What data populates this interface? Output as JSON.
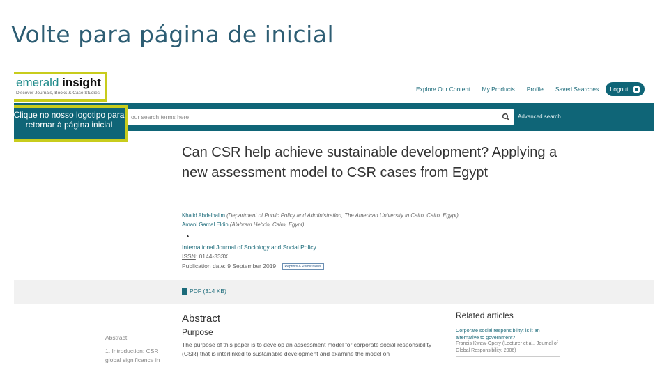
{
  "slide": {
    "title": "Volte para página de inicial"
  },
  "logo": {
    "part1": "emerald",
    "part2": " insight",
    "tagline": "Discover Journals, Books & Case Studies"
  },
  "callout": {
    "text": "Clique no nosso logotipo para retornar à página inicial"
  },
  "nav": {
    "items": [
      "Explore Our Content",
      "My Products",
      "Profile",
      "Saved Searches"
    ],
    "logout_label": "Logout"
  },
  "search": {
    "placeholder": "our search terms here",
    "advanced_label": "Advanced search"
  },
  "article": {
    "title": "Can CSR help achieve sustainable development? Applying a new assessment model to CSR cases from Egypt",
    "authors": [
      {
        "name": "Khalid Abdelhalim",
        "affiliation": " (Department of Public Policy and Administration, The American University in Cairo, Cairo, Egypt)"
      },
      {
        "name": "Amani Gamal Eldin",
        "affiliation": " (Alahram Hebdo, Cairo, Egypt)"
      }
    ],
    "caret": "▲",
    "journal": "International Journal of Sociology and Social Policy",
    "issn_label": "ISSN",
    "issn_value": ": 0144-333X",
    "publication_date": "Publication date: 9 September 2019",
    "badge": "Reprints & Permissions",
    "pdf_label": "PDF (314 KB)"
  },
  "abstract": {
    "heading": "Abstract",
    "purpose_heading": "Purpose",
    "body": "The purpose of this paper is to develop an assessment model for corporate social responsibility (CSR) that is interlinked to sustainable development and examine the model on"
  },
  "side_nav": {
    "items": [
      "Abstract",
      "1. Introduction: CSR",
      "global significance in"
    ]
  },
  "related": {
    "heading": "Related articles",
    "link": "Corporate social responsibility: is it an alternative to government?",
    "meta": "Francis Kwaw-Opery (Lecturer et al., Journal of Global Responsibility, 2006)"
  }
}
